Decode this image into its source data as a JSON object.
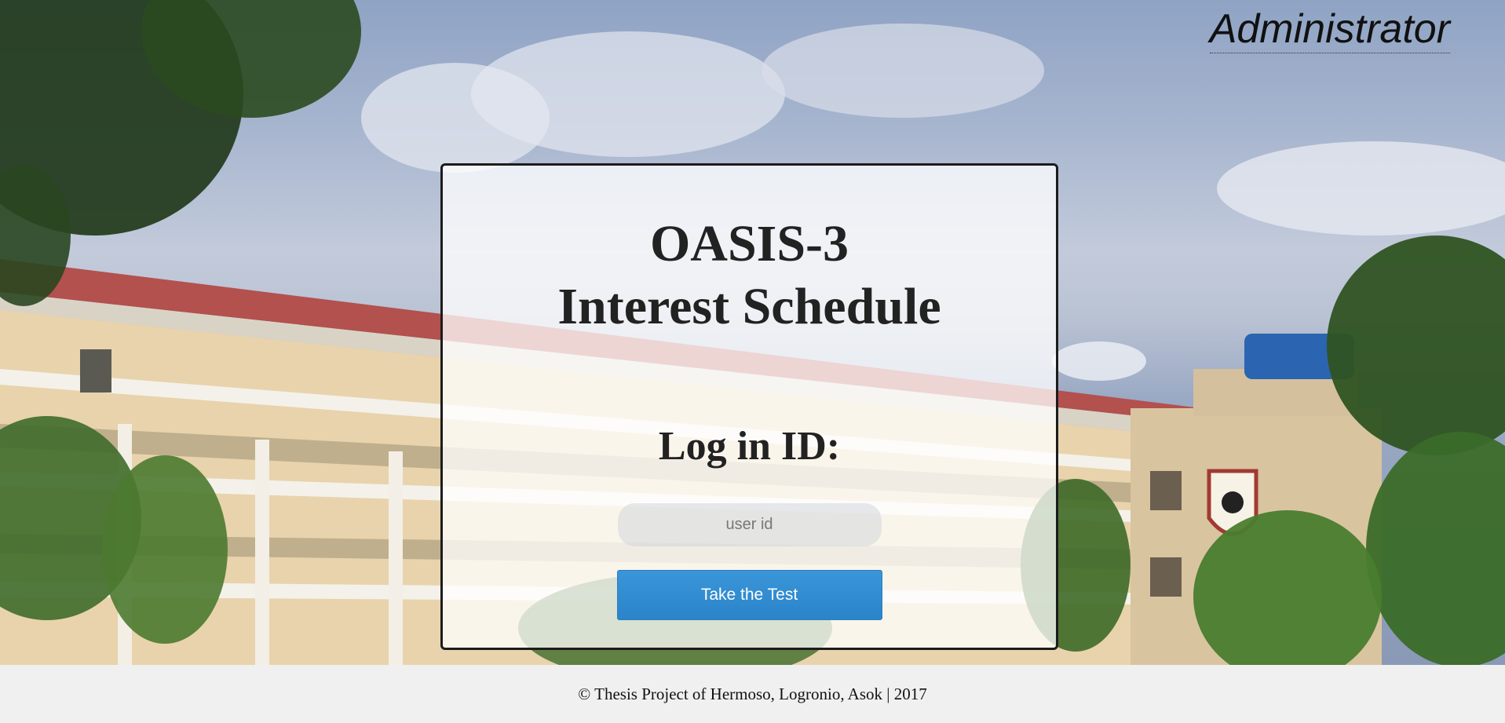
{
  "header": {
    "admin_link_label": "Administrator"
  },
  "login_card": {
    "title_line1": "OASIS-3",
    "title_line2": "Interest Schedule",
    "login_label": "Log in ID:",
    "user_id_placeholder": "user id",
    "user_id_value": "",
    "submit_label": "Take the Test"
  },
  "footer": {
    "copyright": "© Thesis Project of Hermoso, Logronio, Asok | 2017"
  },
  "colors": {
    "button": "#2b84c9",
    "footer_bg": "#f0f0f0",
    "card_border": "#1c1c1c"
  }
}
